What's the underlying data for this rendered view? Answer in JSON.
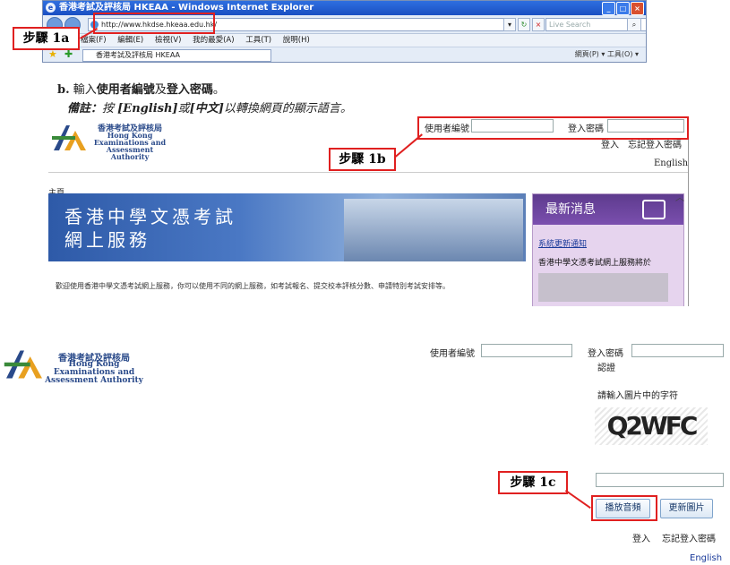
{
  "browser": {
    "title": "香港考試及評核局 HKEAA - Windows Internet Explorer",
    "address": "http://www.hkdse.hkeaa.edu.hk/",
    "search_placeholder": "Live Search",
    "menu": [
      "檔案(F)",
      "編輯(E)",
      "檢視(V)",
      "我的最愛(A)",
      "工具(T)",
      "說明(H)"
    ],
    "tab_label": "香港考試及評核局 HKEAA",
    "right_tools": "網頁(P) ▾  工具(O) ▾"
  },
  "steps": {
    "a": "步驟 1a",
    "b": "步驟 1b",
    "c": "步驟 1c"
  },
  "instruction": {
    "marker": "b.",
    "text_pre": "輸入",
    "username_bold": "使用者編號",
    "and": "及",
    "password_bold": "登入密碼",
    "end": "。",
    "note_label": "備註：",
    "note_pre": "按 ",
    "note_en": "[English]",
    "note_or": "或",
    "note_zh": "[中文]",
    "note_post": "以轉換網頁的顯示語言。"
  },
  "logo": {
    "chinese": "香港考試及評核局",
    "line1": "Hong Kong",
    "line2": "Examinations and",
    "line3": "Assessment Authority"
  },
  "login1": {
    "username_label": "使用者編號",
    "password_label": "登入密碼",
    "login_link": "登入",
    "forgot_link": "忘記登入密碼",
    "english_link": "English",
    "home_label": "主頁"
  },
  "banner": {
    "line1": "香港中學文憑考試",
    "line2": "網上服務"
  },
  "news": {
    "title": "最新消息",
    "link": "系統更新通知",
    "item": "香港中學文憑考試網上服務將於"
  },
  "welcome": "歡迎使用香港中學文憑考試網上服務，你可以使用不同的網上服務，如考試報名、提交校本評核分數、申請特別考試安排等。",
  "login2": {
    "username_label": "使用者編號",
    "password_label": "登入密碼",
    "verify_label": "認證",
    "prompt": "請輸入圖片中的字符",
    "captcha": "Q2WFC",
    "play_audio": "播放音頻",
    "refresh_image": "更新圖片",
    "login_link": "登入",
    "forgot_link": "忘記登入密碼",
    "english_link": "English"
  },
  "colors": {
    "accent_red": "#e02020",
    "link_blue": "#1a3a9a",
    "news_purple": "#6a45a0"
  }
}
